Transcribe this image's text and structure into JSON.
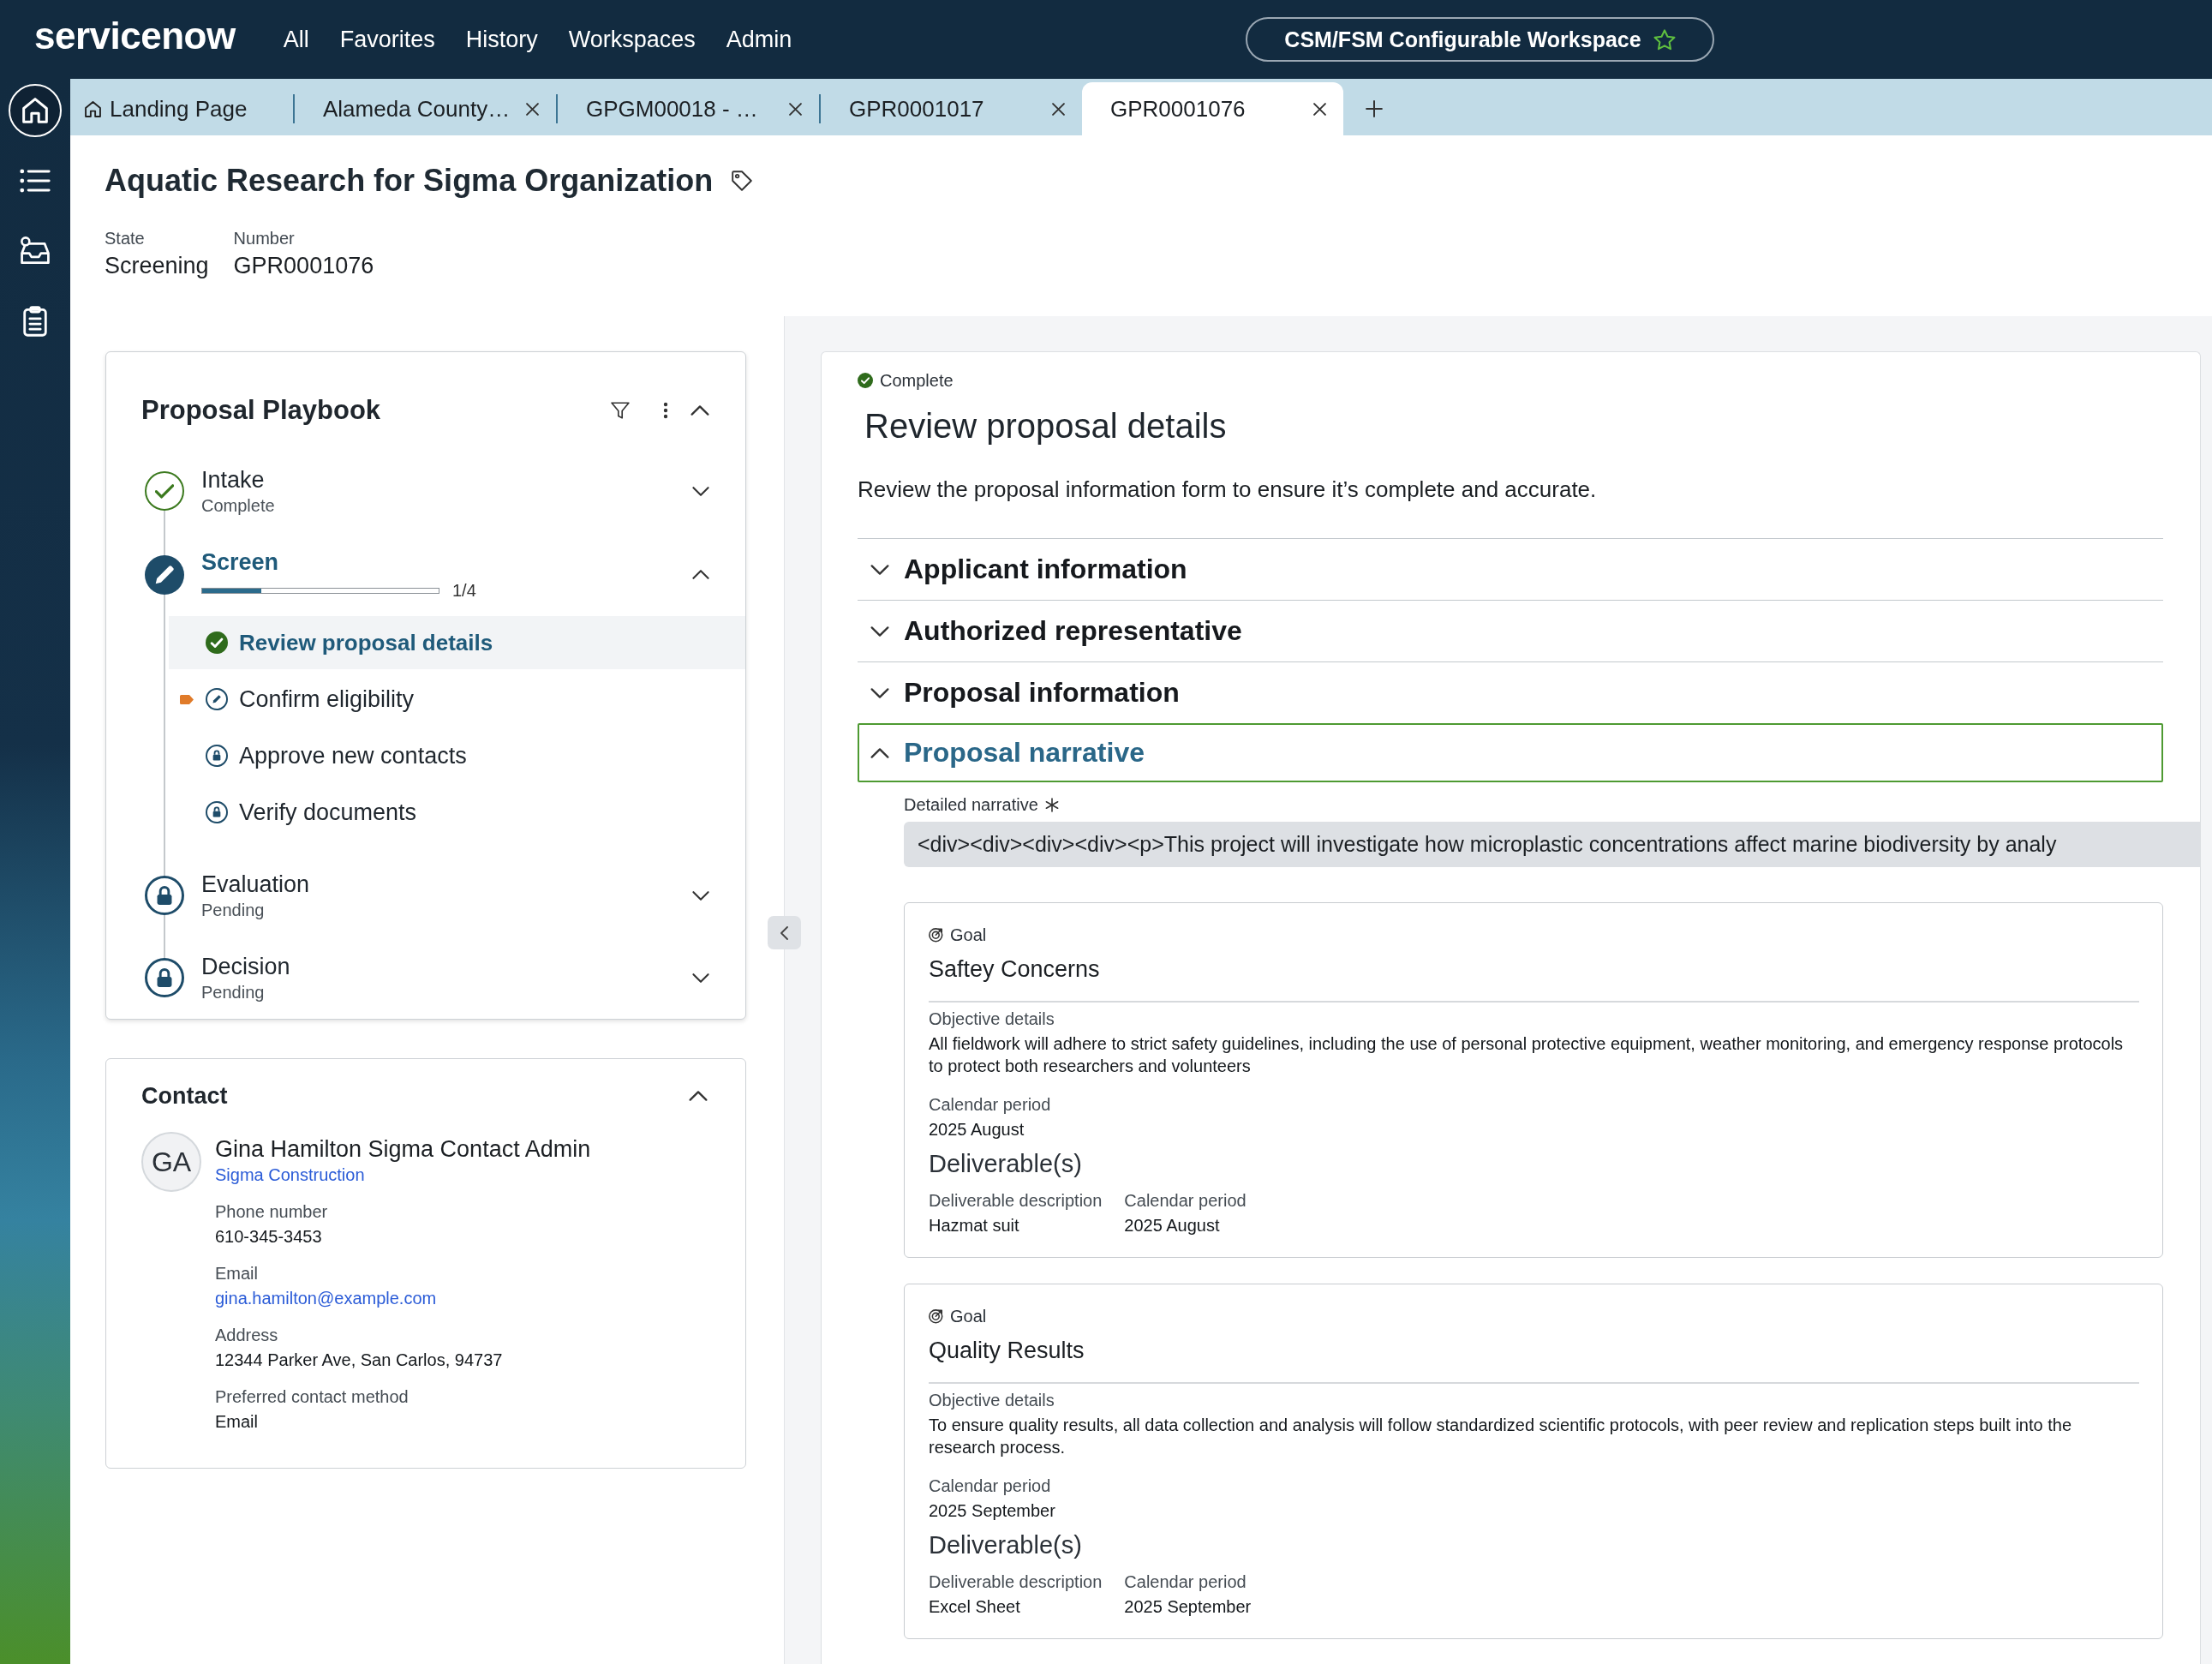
{
  "topbar": {
    "logo": "servicenow",
    "menu": [
      "All",
      "Favorites",
      "History",
      "Workspaces",
      "Admin"
    ],
    "workspace": "CSM/FSM Configurable Workspace"
  },
  "rail": [
    {
      "kind": "home",
      "selected": true
    },
    {
      "kind": "list",
      "selected": false
    },
    {
      "kind": "inbox",
      "selected": false
    },
    {
      "kind": "clipboard",
      "selected": false
    }
  ],
  "tabs": [
    {
      "kind": "home",
      "label": "Landing Page",
      "selected": false
    },
    {
      "kind": "record",
      "label": "Alameda County…",
      "selected": false
    },
    {
      "kind": "record",
      "label": "GPGM00018 - …",
      "selected": false
    },
    {
      "kind": "record",
      "label": "GPR0001017",
      "selected": false
    },
    {
      "kind": "record",
      "label": "GPR0001076",
      "selected": true
    }
  ],
  "record": {
    "title": "Aquatic Research for Sigma Organization",
    "fields": [
      {
        "label": "State",
        "value": "Screening"
      },
      {
        "label": "Number",
        "value": "GPR0001076"
      }
    ]
  },
  "playbook": {
    "title": "Proposal Playbook",
    "expanded": true,
    "stages": [
      {
        "kind": "complete",
        "name": "Intake",
        "status_text": "Complete",
        "expanded": false
      },
      {
        "kind": "active",
        "name": "Screen",
        "expanded": true,
        "progress": {
          "level": 0.25,
          "reading": "1/4"
        },
        "activities": [
          {
            "kind": "complete",
            "label": "Review proposal details",
            "selected": true,
            "current": false
          },
          {
            "kind": "active",
            "label": "Confirm eligibility",
            "selected": false,
            "current": true
          },
          {
            "kind": "locked",
            "label": "Approve new contacts",
            "selected": false,
            "current": false
          },
          {
            "kind": "locked",
            "label": "Verify documents",
            "selected": false,
            "current": false
          }
        ]
      },
      {
        "kind": "pending",
        "name": "Evaluation",
        "status_text": "Pending",
        "expanded": false
      },
      {
        "kind": "pending",
        "name": "Decision",
        "status_text": "Pending",
        "expanded": false
      }
    ]
  },
  "contact": {
    "title": "Contact",
    "expanded": true,
    "initials": "GA",
    "name": "Gina Hamilton Sigma Contact Admin",
    "company": "Sigma Construction",
    "fields": [
      {
        "kind": "text",
        "label": "Phone number",
        "value": "610-345-3453"
      },
      {
        "kind": "link",
        "label": "Email",
        "value": "gina.hamilton@example.com"
      },
      {
        "kind": "text",
        "label": "Address",
        "value": "12344 Parker Ave, San Carlos, 94737"
      },
      {
        "kind": "text",
        "label": "Preferred contact method",
        "value": "Email"
      }
    ]
  },
  "activity": {
    "kind": "complete",
    "status_text": "Complete",
    "title": "Review proposal details",
    "description": "Review the proposal information form to ensure it’s complete and accurate.",
    "sections": [
      {
        "title": "Applicant information",
        "expanded": false,
        "focused": false
      },
      {
        "title": "Authorized representative",
        "expanded": false,
        "focused": false
      },
      {
        "title": "Proposal information",
        "expanded": false,
        "focused": false
      },
      {
        "title": "Proposal narrative",
        "expanded": true,
        "focused": true,
        "field": {
          "label": "Detailed narrative",
          "required": true,
          "value": "<div><div><div><div><p>This project will investigate how microplastic concentrations affect marine biodiversity by analy"
        },
        "goals": [
          {
            "kind_label": "Goal",
            "title": "Saftey Concerns",
            "objective_label": "Objective details",
            "objective": "All fieldwork will adhere to strict safety guidelines, including the use of personal protective equipment, weather monitoring, and emergency response protocols to protect both researchers and volunteers",
            "period_label": "Calendar period",
            "period": "2025 August",
            "deliverables": {
              "title": "Deliverable(s)",
              "columns": [
                "Deliverable description",
                "Calendar period"
              ],
              "rows": [
                [
                  "Hazmat suit",
                  "2025 August"
                ]
              ]
            }
          },
          {
            "kind_label": "Goal",
            "title": "Quality Results",
            "objective_label": "Objective details",
            "objective": "To ensure quality results, all data collection and analysis will follow standardized scientific protocols, with peer review and replication steps built into the research process.",
            "period_label": "Calendar period",
            "period": "2025 September",
            "deliverables": {
              "title": "Deliverable(s)",
              "columns": [
                "Deliverable description",
                "Calendar period"
              ],
              "rows": [
                [
                  "Excel Sheet",
                  "2025 September"
                ]
              ]
            }
          }
        ]
      }
    ]
  }
}
